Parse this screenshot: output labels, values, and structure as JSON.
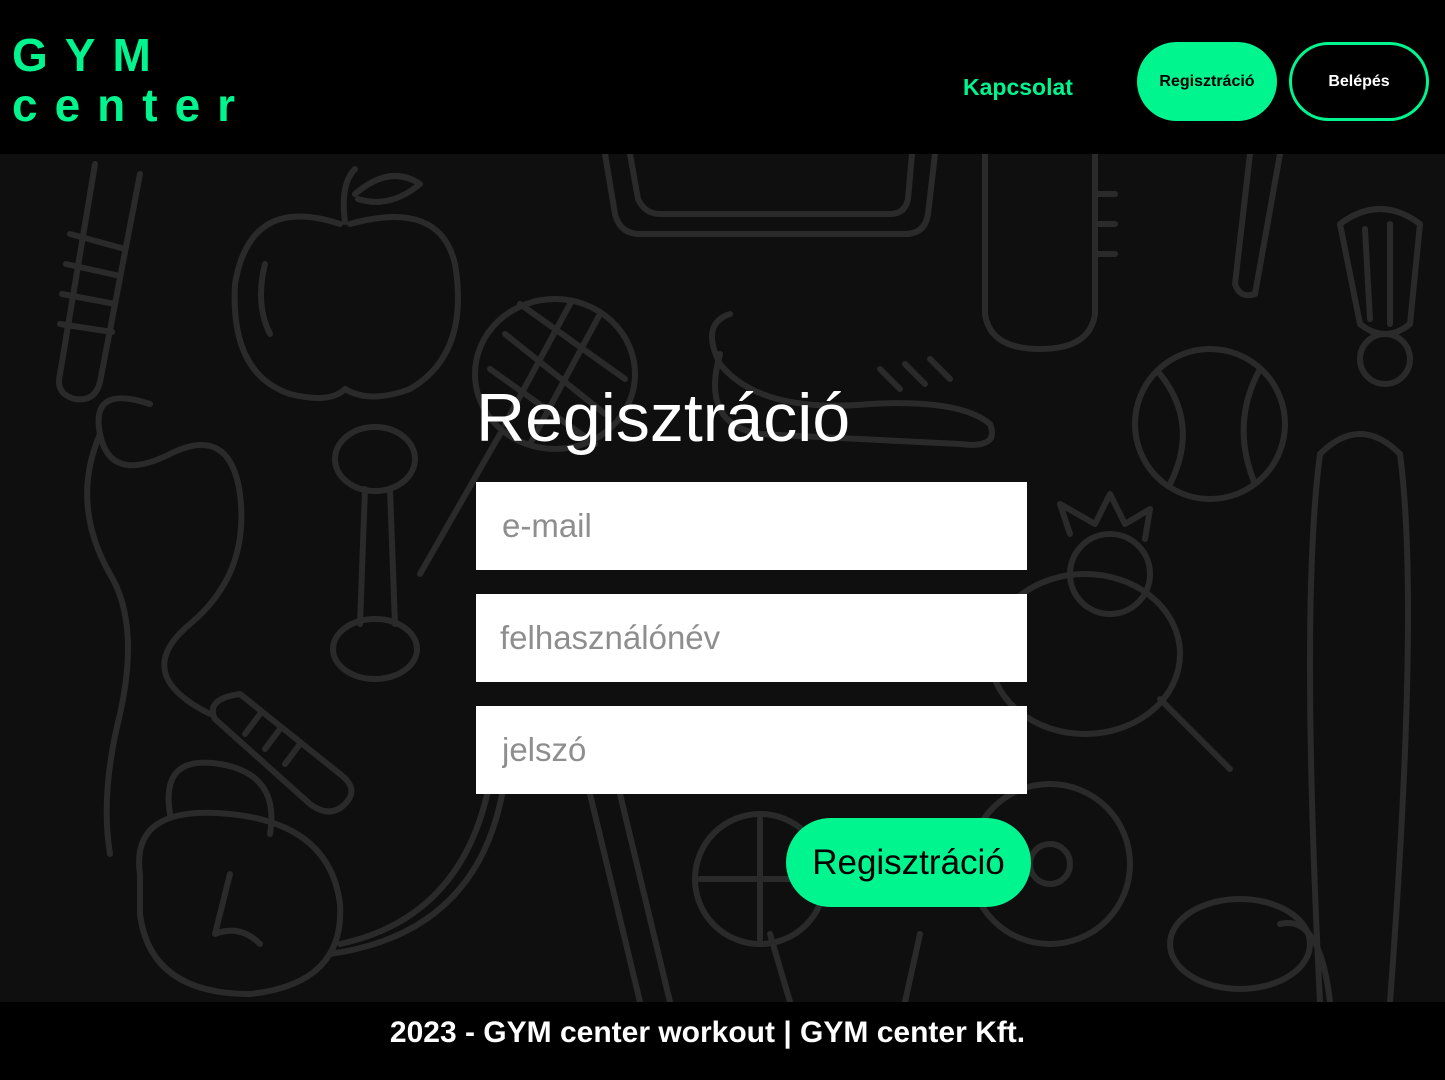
{
  "header": {
    "logo_line1": "GYM",
    "logo_line2": "center",
    "nav_contact": "Kapcsolat",
    "register_button": "Regisztráció",
    "login_button": "Belépés"
  },
  "form": {
    "title": "Regisztráció",
    "email_placeholder": "e-mail",
    "username_placeholder": "felhasználónév",
    "password_placeholder": "jelszó",
    "submit_label": "Regisztráció"
  },
  "footer": {
    "text": "2023 - GYM center workout | GYM center Kft."
  },
  "colors": {
    "accent": "#00f58f",
    "background": "#000000",
    "pattern_bg": "#0f0f0f",
    "pattern_stroke": "#2a2a2a"
  }
}
